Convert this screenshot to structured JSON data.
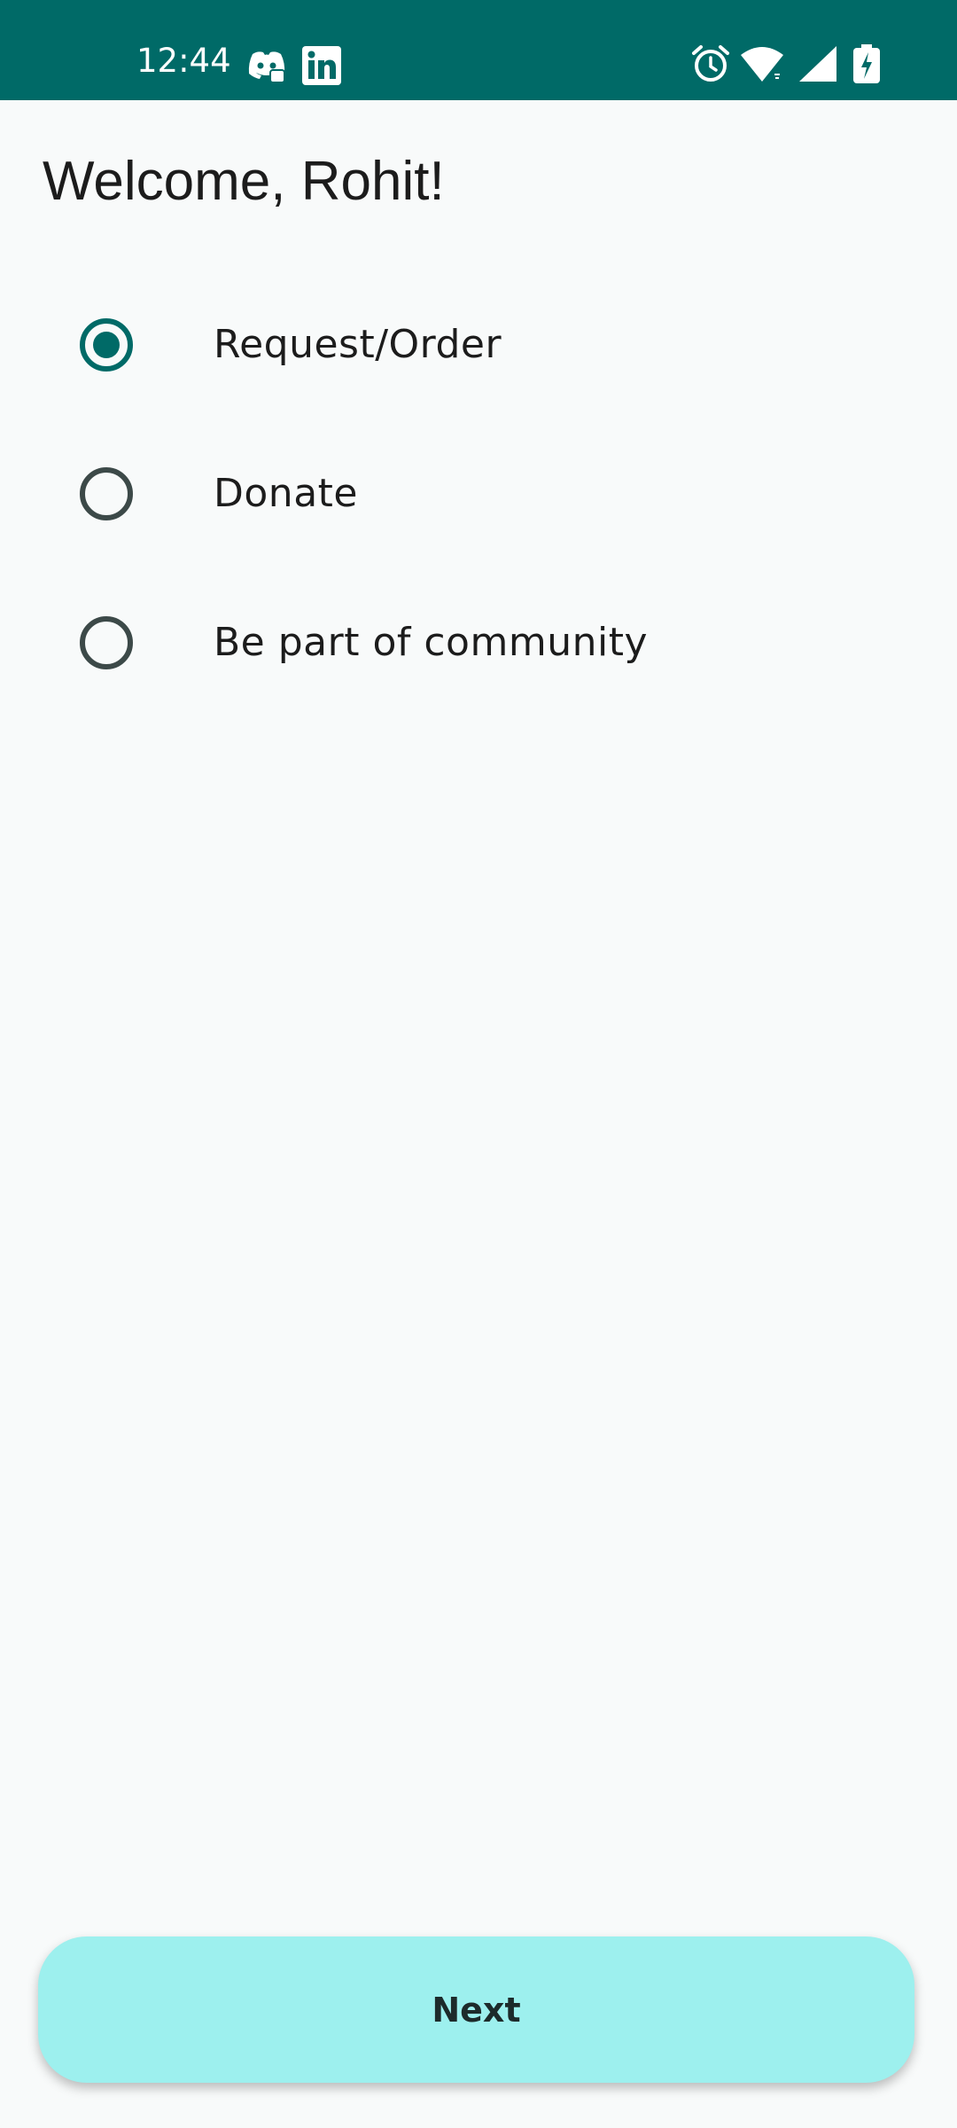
{
  "status_bar": {
    "time": "12:44",
    "background_color": "#006a67",
    "left_icons": [
      "discord-icon",
      "linkedin-icon"
    ],
    "right_icons": [
      "alarm-icon",
      "wifi-icon",
      "cellular-signal-icon",
      "battery-charging-icon"
    ]
  },
  "welcome": {
    "title": "Welcome, Rohit!"
  },
  "options": [
    {
      "label": "Request/Order",
      "selected": true
    },
    {
      "label": "Donate",
      "selected": false
    },
    {
      "label": "Be part of community",
      "selected": false
    }
  ],
  "footer": {
    "next_label": "Next",
    "button_color": "#9df0ee"
  },
  "colors": {
    "accent": "#006a67",
    "background": "#f8fafa",
    "radio_unselected": "#3c4948"
  }
}
